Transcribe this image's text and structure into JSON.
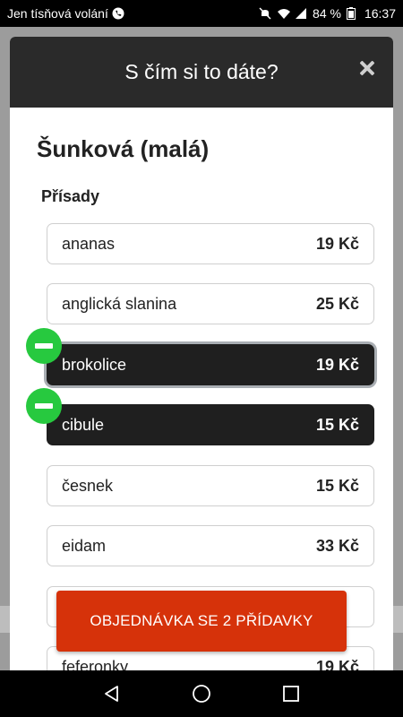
{
  "status_bar": {
    "carrier": "Jen tísňová volání",
    "battery": "84 %",
    "time": "16:37"
  },
  "modal": {
    "title": "S čím si to dáte?",
    "product_name": "Šunková (malá)",
    "section_title": "Přísady"
  },
  "ingredients": [
    {
      "name": "ananas",
      "price": "19 Kč",
      "selected": false
    },
    {
      "name": "anglická slanina",
      "price": "25 Kč",
      "selected": false
    },
    {
      "name": "brokolice",
      "price": "19 Kč",
      "selected": true
    },
    {
      "name": "cibule",
      "price": "15 Kč",
      "selected": true
    },
    {
      "name": "česnek",
      "price": "15 Kč",
      "selected": false
    },
    {
      "name": "eidam",
      "price": "33 Kč",
      "selected": false
    },
    {
      "name": "",
      "price": "",
      "selected": false
    },
    {
      "name": "feferonky",
      "price": "19 Kč",
      "selected": false
    }
  ],
  "order_button": {
    "label": "OBJEDNÁVKA SE 2 PŘÍDAVKY"
  },
  "colors": {
    "header_bg": "#2a2a2a",
    "selected_bg": "#1f1f1f",
    "badge_green": "#27c93f",
    "order_button_bg": "#d6320a"
  }
}
